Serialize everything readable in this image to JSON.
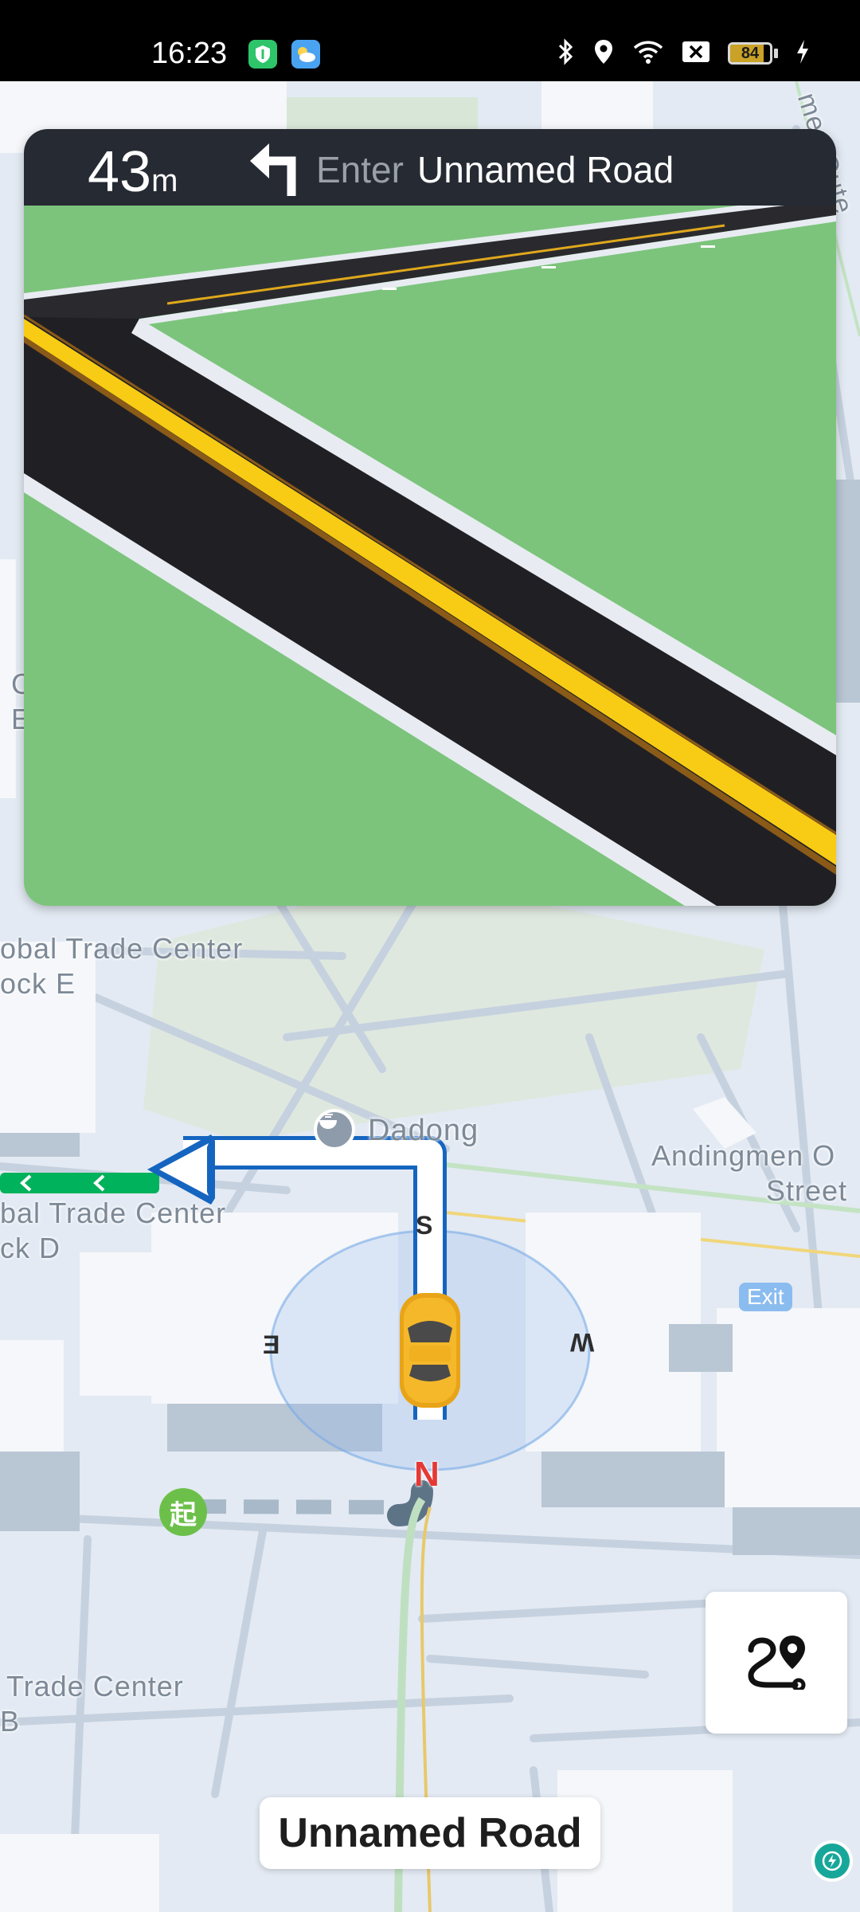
{
  "status_bar": {
    "time": "16:23",
    "left_icons": [
      "shield-app-icon",
      "weather-app-icon"
    ],
    "right_icons": [
      "bluetooth-icon",
      "location-icon",
      "wifi-icon",
      "sim-blocked-icon",
      "battery-icon",
      "charging-icon"
    ],
    "battery_level": "84",
    "battery_fraction": 0.84
  },
  "guidance": {
    "distance_value": "43",
    "distance_unit": "m",
    "maneuver_icon": "turn-left-icon",
    "action": "Enter",
    "road_name": "Unnamed Road"
  },
  "map": {
    "labels": {
      "global_e_line1": "obal Trade Center",
      "global_e_line2": "ock E",
      "poi_dadong": "Dadong",
      "andingmen_line1": "Andingmen O",
      "andingmen_line2": "Street",
      "global_d_line1": "bal Trade Center",
      "global_d_line2": "ck D",
      "exit_badge": "Exit",
      "trade_b_line1": "Trade Center",
      "trade_b_line2": "B",
      "start_marker": "起",
      "left_edge_c": "C",
      "left_edge_e": "E",
      "top_right_road": "men Oute"
    },
    "compass": {
      "north": "N",
      "south": "S",
      "east": "E",
      "west": "W"
    },
    "colors": {
      "route": "#1a73e8",
      "traveled": "#00b25b",
      "start_marker": "#5cb85c"
    }
  },
  "controls": {
    "route_overview_icon": "route-overview-icon",
    "current_road": "Unnamed Road",
    "eco_icon": "eco-charge-icon"
  }
}
